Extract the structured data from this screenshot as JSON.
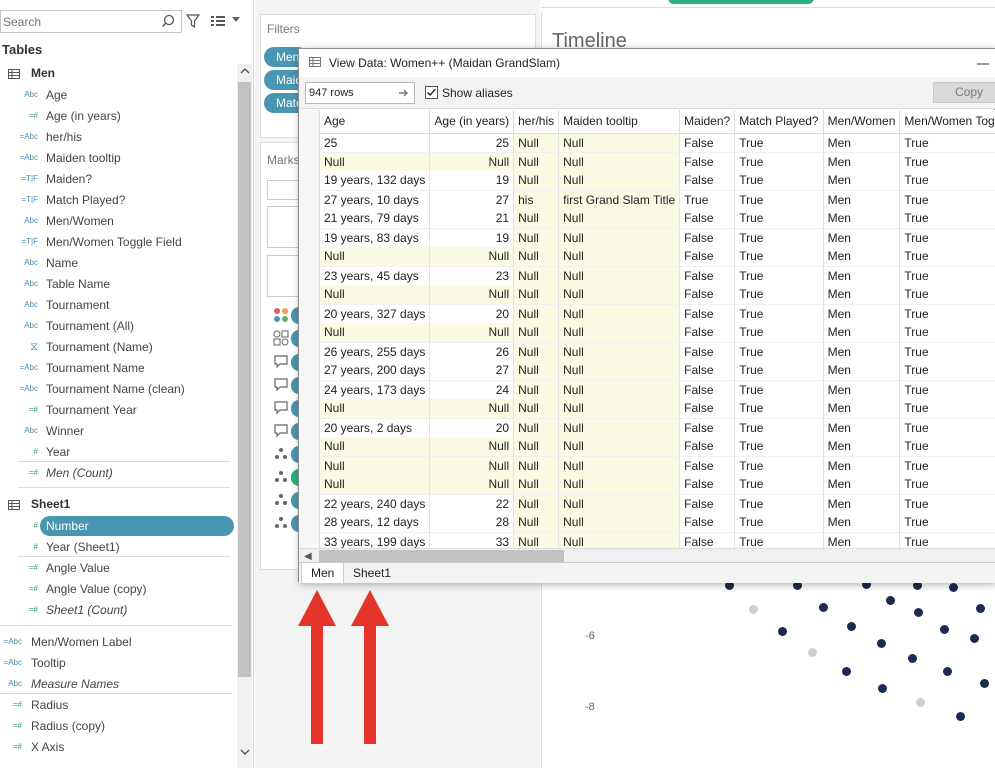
{
  "left_pane": {
    "search_placeholder": "Search",
    "tables_heading": "Tables",
    "groups": [
      {
        "name": "Men",
        "fields": [
          {
            "type": "Abc",
            "label": "Age"
          },
          {
            "type": "=#",
            "label": "Age (in years)"
          },
          {
            "type": "=Abc",
            "label": "her/his"
          },
          {
            "type": "=Abc",
            "label": "Maiden tooltip"
          },
          {
            "type": "=T|F",
            "label": "Maiden?"
          },
          {
            "type": "=T|F",
            "label": "Match Played?"
          },
          {
            "type": "Abc",
            "label": "Men/Women"
          },
          {
            "type": "=T|F",
            "label": "Men/Women Toggle Field"
          },
          {
            "type": "Abc",
            "label": "Name"
          },
          {
            "type": "Abc",
            "label": "Table Name"
          },
          {
            "type": "Abc",
            "label": "Tournament"
          },
          {
            "type": "Abc",
            "label": "Tournament (All)"
          },
          {
            "type": "clip",
            "label": "Tournament (Name)"
          },
          {
            "type": "=Abc",
            "label": "Tournament Name"
          },
          {
            "type": "=Abc",
            "label": "Tournament Name (clean)"
          },
          {
            "type": "=#",
            "label": "Tournament Year"
          },
          {
            "type": "Abc",
            "label": "Winner"
          },
          {
            "type": "#",
            "label": "Year"
          },
          {
            "type": "=#",
            "label": "Men (Count)"
          }
        ]
      },
      {
        "name": "Sheet1",
        "fields": [
          {
            "type": "#",
            "label": "Number"
          },
          {
            "type": "#",
            "label": "Year (Sheet1)"
          },
          {
            "type": "=#",
            "label": "Angle Value"
          },
          {
            "type": "=#",
            "label": "Angle Value (copy)"
          },
          {
            "type": "=#",
            "label": "Sheet1 (Count)"
          }
        ]
      }
    ],
    "loose_fields": [
      {
        "type": "=Abc",
        "label": "Men/Women Label"
      },
      {
        "type": "=Abc",
        "label": "Tooltip"
      },
      {
        "type": "Abc",
        "label": "Measure Names"
      },
      {
        "type": "=#",
        "label": "Radius"
      },
      {
        "type": "=#",
        "label": "Radius (copy)"
      },
      {
        "type": "=#",
        "label": "X Axis"
      }
    ]
  },
  "mid_pane": {
    "filters_title": "Filters",
    "filter_pills": [
      "Men",
      "Maid",
      "Matc"
    ],
    "marks_title": "Marks"
  },
  "view": {
    "title": "Timeline",
    "y_ticks": [
      "-6",
      "-8"
    ]
  },
  "dialog": {
    "title": "View Data: Women++ (Maidan GrandSlam)",
    "rows_value": "947 rows",
    "show_aliases_label": "Show aliases",
    "show_aliases_checked": true,
    "copy_label": "Copy",
    "columns": [
      "Age",
      "Age (in years)",
      "her/his",
      "Maiden tooltip",
      "Maiden?",
      "Match Played?",
      "Men/Women",
      "Men/Women Toggle Field"
    ],
    "rows": [
      [
        "25",
        "25",
        "Null",
        "Null",
        "False",
        "True",
        "Men",
        "True"
      ],
      [
        "Null",
        "Null",
        "Null",
        "Null",
        "False",
        "True",
        "Men",
        "True"
      ],
      [
        "19 years, 132 days",
        "19",
        "Null",
        "Null",
        "False",
        "True",
        "Men",
        "True"
      ],
      [
        "27 years, 10 days",
        "27",
        "his",
        "first Grand Slam Title",
        "True",
        "True",
        "Men",
        "True"
      ],
      [
        "21 years, 79 days",
        "21",
        "Null",
        "Null",
        "False",
        "True",
        "Men",
        "True"
      ],
      [
        "19 years, 83 days",
        "19",
        "Null",
        "Null",
        "False",
        "True",
        "Men",
        "True"
      ],
      [
        "Null",
        "Null",
        "Null",
        "Null",
        "False",
        "True",
        "Men",
        "True"
      ],
      [
        "23 years, 45 days",
        "23",
        "Null",
        "Null",
        "False",
        "True",
        "Men",
        "True"
      ],
      [
        "Null",
        "Null",
        "Null",
        "Null",
        "False",
        "True",
        "Men",
        "True"
      ],
      [
        "20 years, 327 days",
        "20",
        "Null",
        "Null",
        "False",
        "True",
        "Men",
        "True"
      ],
      [
        "Null",
        "Null",
        "Null",
        "Null",
        "False",
        "True",
        "Men",
        "True"
      ],
      [
        "26 years, 255 days",
        "26",
        "Null",
        "Null",
        "False",
        "True",
        "Men",
        "True"
      ],
      [
        "27 years, 200 days",
        "27",
        "Null",
        "Null",
        "False",
        "True",
        "Men",
        "True"
      ],
      [
        "24 years, 173 days",
        "24",
        "Null",
        "Null",
        "False",
        "True",
        "Men",
        "True"
      ],
      [
        "Null",
        "Null",
        "Null",
        "Null",
        "False",
        "True",
        "Men",
        "True"
      ],
      [
        "20 years, 2 days",
        "20",
        "Null",
        "Null",
        "False",
        "True",
        "Men",
        "True"
      ],
      [
        "Null",
        "Null",
        "Null",
        "Null",
        "False",
        "True",
        "Men",
        "True"
      ],
      [
        "Null",
        "Null",
        "Null",
        "Null",
        "False",
        "True",
        "Men",
        "True"
      ],
      [
        "Null",
        "Null",
        "Null",
        "Null",
        "False",
        "True",
        "Men",
        "True"
      ],
      [
        "22 years, 240 days",
        "22",
        "Null",
        "Null",
        "False",
        "True",
        "Men",
        "True"
      ],
      [
        "28 years, 12 days",
        "28",
        "Null",
        "Null",
        "False",
        "True",
        "Men",
        "True"
      ],
      [
        "33 years, 199 days",
        "33",
        "Null",
        "Null",
        "False",
        "True",
        "Men",
        "True"
      ]
    ],
    "tabs": [
      "Men",
      "Sheet1"
    ],
    "active_tab": "Men"
  },
  "colors": {
    "accent_pill": "#4996b2",
    "green_pill": "#2ab07f",
    "annotation_arrow": "#e5352b",
    "dot_dark": "#1b2a4e",
    "dot_light": "#cfcfcf"
  }
}
